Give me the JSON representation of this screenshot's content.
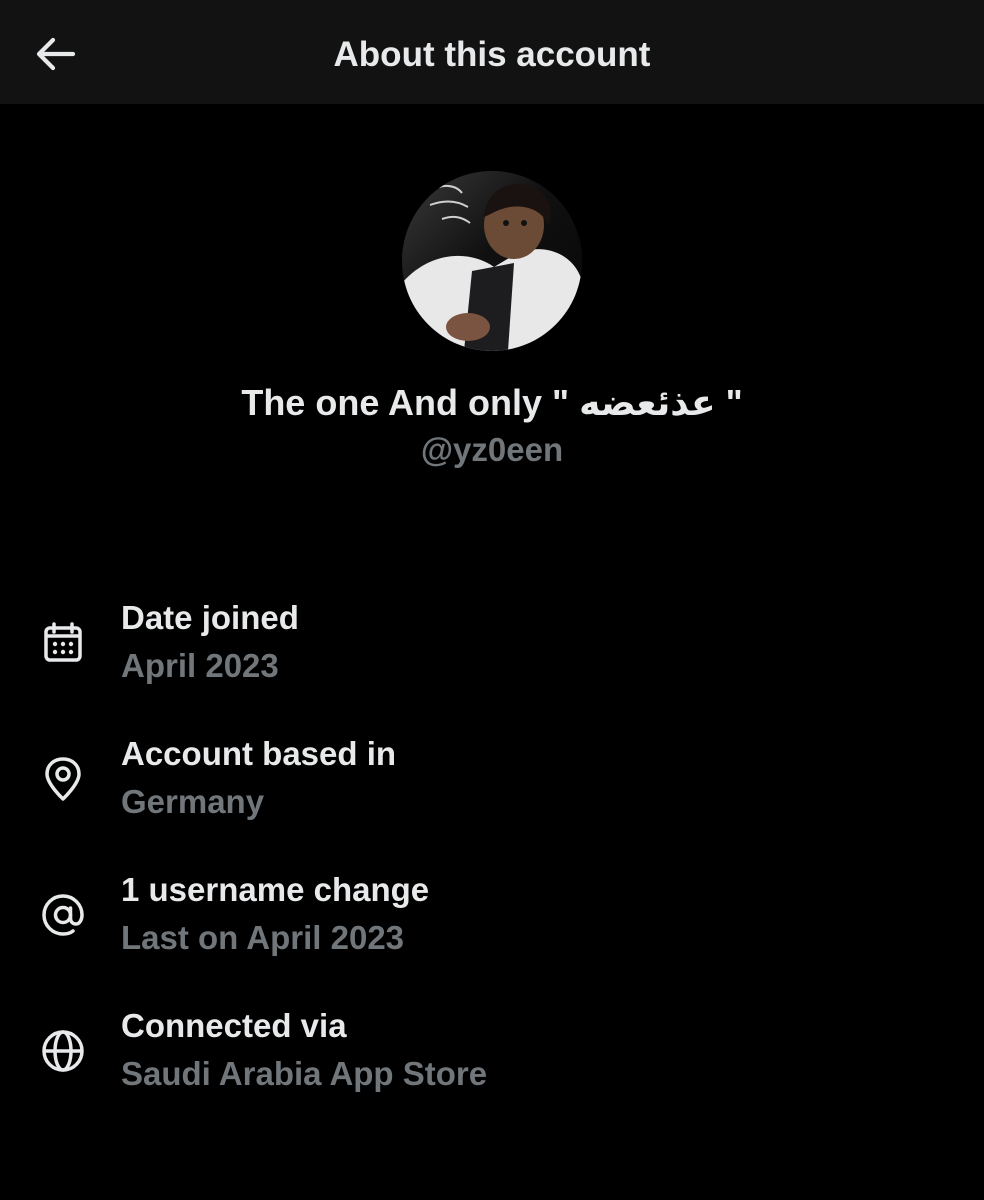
{
  "header": {
    "title": "About this account"
  },
  "profile": {
    "display_name": "The one And only \" عذئعضه \"",
    "handle": "@yz0een"
  },
  "info": [
    {
      "icon": "calendar-icon",
      "label": "Date joined",
      "value": "April 2023"
    },
    {
      "icon": "location-pin-icon",
      "label": "Account based in",
      "value": "Germany"
    },
    {
      "icon": "at-sign-icon",
      "label": "1 username change",
      "value": "Last on April 2023"
    },
    {
      "icon": "globe-icon",
      "label": "Connected via",
      "value": "Saudi Arabia App Store"
    }
  ],
  "colors": {
    "background": "#000000",
    "header_background": "#121212",
    "primary_text": "#e7e9ea",
    "secondary_text": "#71767b"
  }
}
